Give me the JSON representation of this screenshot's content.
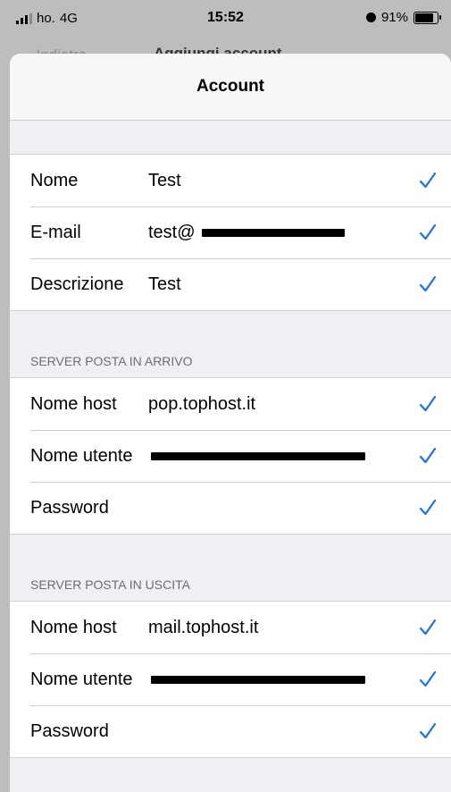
{
  "status": {
    "carrier": "ho.",
    "network": "4G",
    "time": "15:52",
    "battery": "91%",
    "battery_level": 0.91,
    "icons": [
      "signal-icon",
      "alarm-icon",
      "battery-icon"
    ]
  },
  "behind": {
    "back_label": "Indietro",
    "title": "Aggiungi account"
  },
  "sheet": {
    "title": "Account"
  },
  "account": {
    "rows": [
      {
        "label": "Nome",
        "value": "Test"
      },
      {
        "label": "E-mail",
        "value": "test@"
      },
      {
        "label": "Descrizione",
        "value": "Test"
      }
    ]
  },
  "incoming": {
    "header": "SERVER POSTA IN ARRIVO",
    "rows": [
      {
        "label": "Nome host",
        "value": "pop.tophost.it"
      },
      {
        "label": "Nome utente",
        "value": ""
      },
      {
        "label": "Password",
        "value": ""
      }
    ]
  },
  "outgoing": {
    "header": "SERVER POSTA IN USCITA",
    "rows": [
      {
        "label": "Nome host",
        "value": "mail.tophost.it"
      },
      {
        "label": "Nome utente",
        "value": ""
      },
      {
        "label": "Password",
        "value": ""
      }
    ]
  },
  "colors": {
    "accent": "#1a73e8",
    "group_text": "#6d6d72",
    "background": "#efeff4"
  }
}
